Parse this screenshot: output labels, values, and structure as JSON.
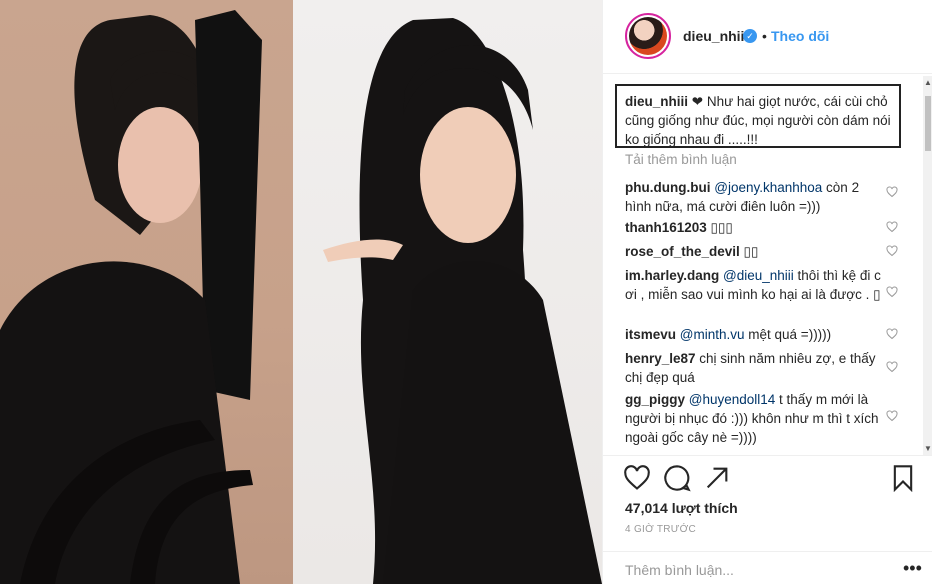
{
  "header": {
    "username": "dieu_nhiii",
    "dot": "•",
    "follow_label": "Theo dõi"
  },
  "caption": {
    "username": "dieu_nhiii",
    "text": " ❤ Như hai giọt nước, cái cùi chỏ cũng giống như đúc, mọi người còn dám nói ko giống nhau đi .....!!!"
  },
  "load_more": "Tải thêm bình luận",
  "comments": [
    {
      "user": "phu.dung.bui",
      "mention": "@joeny.khanhhoa",
      "text": " còn 2 hình nữa, má cười điên luôn =)))"
    },
    {
      "user": "thanh161203",
      "mention": "",
      "text": " ▯▯▯"
    },
    {
      "user": "rose_of_the_devil",
      "mention": "",
      "text": " ▯▯"
    },
    {
      "user": "im.harley.dang",
      "mention": "@dieu_nhiii",
      "text": " thôi thì kệ đi c ơi , miễn sao vui mình ko hại ai là được . ▯"
    },
    {
      "user": "itsmevu",
      "mention": "@minth.vu",
      "text": " mệt quá =)))))"
    },
    {
      "user": "henry_le87",
      "mention": "",
      "text": " chị sinh năm nhiêu zợ, e thấy chị đẹp quá"
    },
    {
      "user": "gg_piggy",
      "mention": "@huyendoll14",
      "text": " t thấy m mới là người bị nhục đó :))) khôn như m thì t xích ngoài gốc cây nè =))))"
    }
  ],
  "likes": "47,014 lượt thích",
  "time": "4 GIỜ TRƯỚC",
  "add_comment": {
    "placeholder": "Thêm bình luận...",
    "more": "•••"
  },
  "icons": {
    "verified": "verified-check-icon",
    "like": "heart-icon",
    "comment": "comment-icon",
    "share": "share-icon",
    "save": "bookmark-icon"
  },
  "colors": {
    "link": "#3897f0",
    "mention": "#003569",
    "muted": "#999999"
  }
}
